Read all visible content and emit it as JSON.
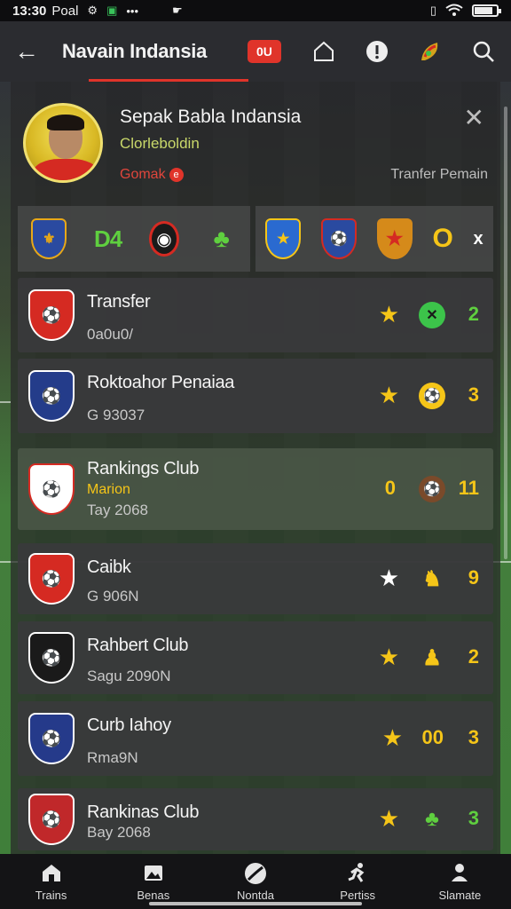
{
  "status_bar": {
    "time": "13:30",
    "carrier": "Poal",
    "dots": "•••",
    "icons": [
      "settings-icon",
      "photo-icon",
      "more-icon",
      "gesture-icon"
    ],
    "battery_level": 0.85
  },
  "app_bar": {
    "title": "Navain Indansia",
    "badge": "0U",
    "icons": [
      "back-icon",
      "home-icon",
      "info-icon",
      "leaf-icon",
      "search-icon"
    ]
  },
  "profile": {
    "name": "Sepak Babla Indansia",
    "subtitle": "Clorleboldin",
    "tag": "Gomak",
    "tag_icon": "e",
    "close_glyph": "✕",
    "transfer_label": "Tranfer Pemain"
  },
  "badge_strip": {
    "left_text_badge": "D4",
    "big_o": "O",
    "x": "x"
  },
  "rows": [
    {
      "title": "Transfer",
      "meta": "0a0u0/",
      "number": "2",
      "star_color": "#f5c518",
      "icon_bg": "#3cc34a",
      "icon_glyph": "✕",
      "num_color": "#5fcf3f",
      "logo_bg": "#d52a22"
    },
    {
      "title": "Roktoahor Penaiaa",
      "meta": "G 93037",
      "number": "3",
      "star_color": "#f5c518",
      "icon_bg": "#f5c518",
      "icon_glyph": "⚽",
      "num_color": "#f5c518",
      "logo_bg": "#243c8a"
    },
    {
      "title": "Rankings Club",
      "meta_highlight": "Marion",
      "meta": "Tay 2068",
      "left_number": "0",
      "number": "11",
      "star_color": "",
      "icon_bg": "#7a4a2a",
      "icon_glyph": "⚽",
      "num_color": "#f5c518",
      "logo_bg": "#ffffff"
    },
    {
      "title": "Caibk",
      "meta": "G 906N",
      "number": "9",
      "star_color": "#ffffff",
      "icon_bg": "",
      "icon_glyph": "♞",
      "num_color": "#f5c518",
      "logo_bg": "#d52a22"
    },
    {
      "title": "Rahbert Club",
      "meta": "Sagu 2090N",
      "number": "2",
      "star_color": "#f5c518",
      "icon_bg": "",
      "icon_glyph": "♟",
      "num_color": "#f5c518",
      "logo_bg": "#1a1a1a"
    },
    {
      "title": "Curb Iahoy",
      "meta": "Rma9N",
      "left_number": "00",
      "number": "3",
      "star_color": "#f5c518",
      "icon_bg": "",
      "icon_glyph": "",
      "num_color": "#f5c518",
      "logo_bg": "#253a8a"
    },
    {
      "title": "Rankinas Club",
      "meta": "Bay 2068",
      "number": "3",
      "star_color": "#f5c518",
      "icon_bg": "",
      "icon_glyph": "♣",
      "num_color": "#5fcf3f",
      "logo_bg": "#c0282a"
    }
  ],
  "bottom_nav": [
    {
      "label": "Trains",
      "icon": "home-icon"
    },
    {
      "label": "Benas",
      "icon": "image-icon"
    },
    {
      "label": "Nontda",
      "icon": "ball-icon"
    },
    {
      "label": "Pertiss",
      "icon": "runner-icon"
    },
    {
      "label": "Slamate",
      "icon": "person-icon"
    }
  ]
}
